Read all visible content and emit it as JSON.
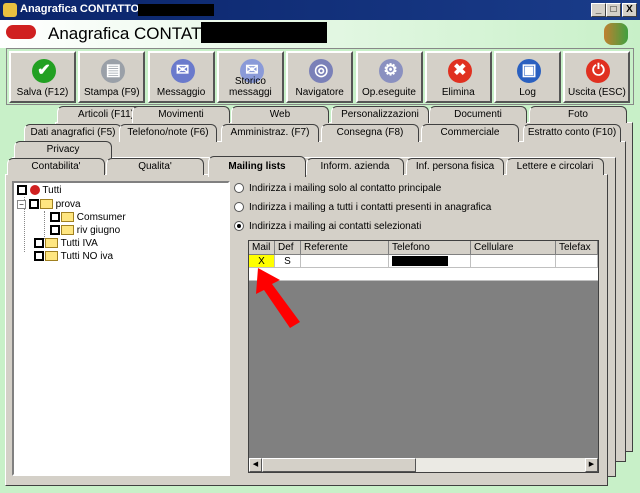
{
  "window": {
    "title": "Anagrafica CONTATTO -",
    "controls": [
      "_",
      "□",
      "X"
    ]
  },
  "header": {
    "title": "Anagrafica CONTATTO -"
  },
  "toolbar": [
    {
      "label": "Salva (F12)",
      "icon": "check-icon",
      "color": "#22a022",
      "glyph": "✔"
    },
    {
      "label": "Stampa (F9)",
      "icon": "printer-icon",
      "color": "#9aa0a8",
      "glyph": "▤"
    },
    {
      "label": "Messaggio",
      "icon": "message-pen-icon",
      "color": "#6a7acc",
      "glyph": "✉"
    },
    {
      "label": "Storico messaggi",
      "icon": "message-search-icon",
      "color": "#8a9ad8",
      "glyph": "✉"
    },
    {
      "label": "Navigatore",
      "icon": "compass-icon",
      "color": "#7a80b8",
      "glyph": "◎"
    },
    {
      "label": "Op.eseguite",
      "icon": "gears-icon",
      "color": "#8a90c0",
      "glyph": "⚙"
    },
    {
      "label": "Elimina",
      "icon": "delete-x-icon",
      "color": "#e03020",
      "glyph": "✖"
    },
    {
      "label": "Log",
      "icon": "log-book-icon",
      "color": "#2a60c0",
      "glyph": "▣"
    },
    {
      "label": "Uscita (ESC)",
      "icon": "exit-power-icon",
      "color": "#e03020",
      "glyph": "⏻"
    }
  ],
  "tabs_row1": [
    "Articoli (F11)",
    "Movimenti",
    "Web",
    "Personalizzazioni",
    "Documenti",
    "Foto"
  ],
  "tabs_row2": [
    "Dati anagrafici (F5)",
    "Telefono/note (F6)",
    "Amministraz. (F7)",
    "Consegna (F8)",
    "Commerciale",
    "Estratto conto (F10)"
  ],
  "tabs_row3": [
    "Privacy"
  ],
  "subtabs": [
    "Contabilita'",
    "Qualita'",
    "Mailing lists",
    "Inform. azienda",
    "Inf. persona fisica",
    "Lettere e circolari"
  ],
  "active_subtab": "Mailing lists",
  "tree": [
    "Tutti",
    "prova",
    "Comsumer",
    "riv giugno",
    "Tutti IVA",
    "Tutti NO iva"
  ],
  "options": [
    {
      "label": "Indirizza i mailing solo al contatto principale",
      "selected": false
    },
    {
      "label": "Indirizza i mailing a tutti i contatti presenti in anagrafica",
      "selected": false
    },
    {
      "label": "Indirizza i mailing ai contatti selezionati",
      "selected": true
    }
  ],
  "grid": {
    "columns": [
      "Mail",
      "Def",
      "Referente",
      "Telefono",
      "Cellulare",
      "Telefax"
    ],
    "rows": [
      [
        "X",
        "S",
        "",
        "",
        "",
        ""
      ]
    ]
  },
  "colors": {
    "highlight": "#ffff00",
    "arrow": "#ff0000"
  }
}
